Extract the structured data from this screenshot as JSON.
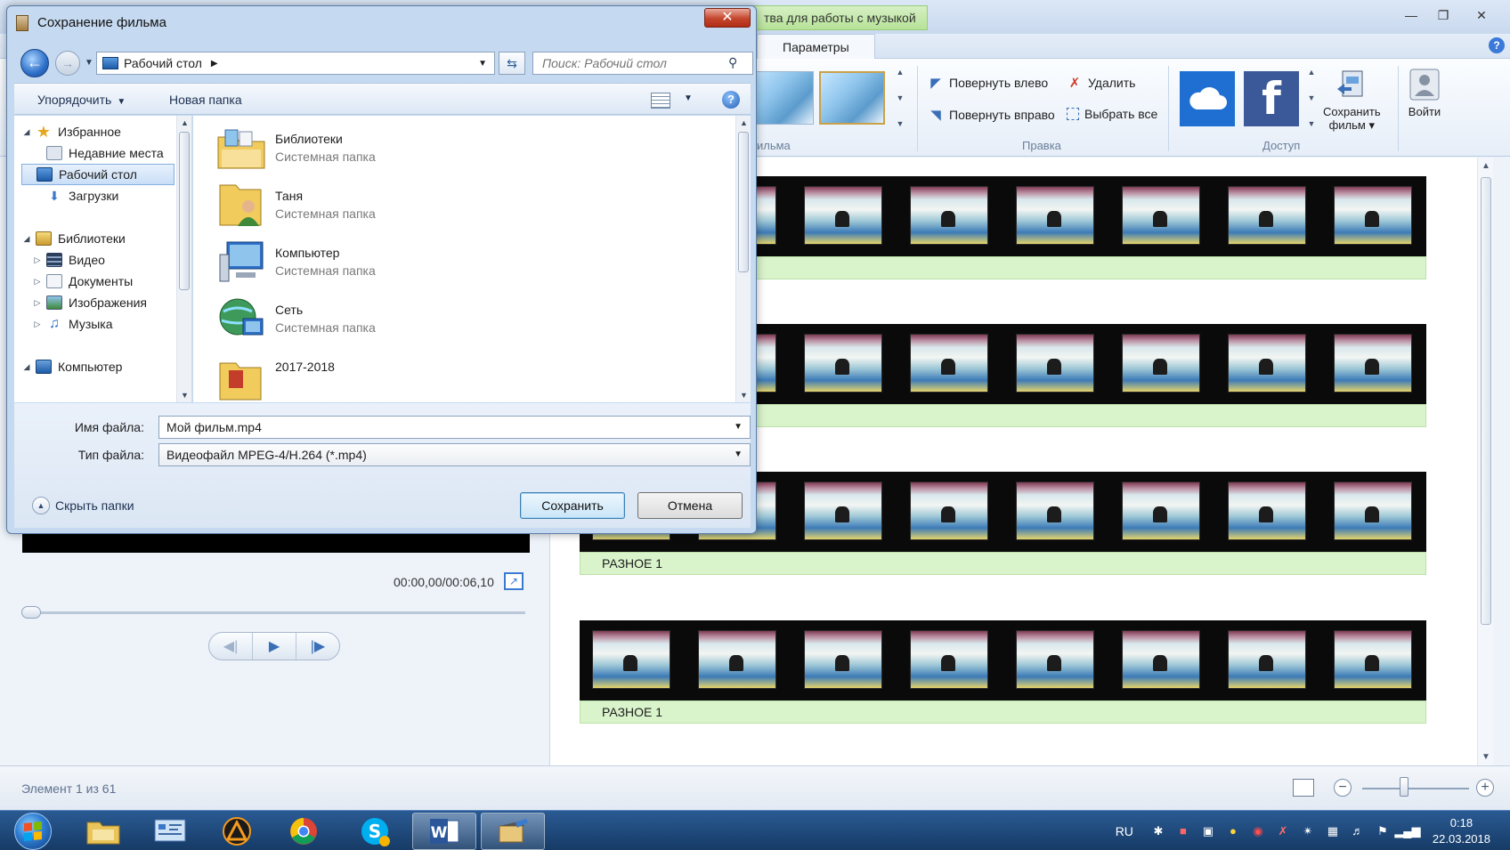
{
  "app": {
    "context_tab": "тва для работы с музыкой",
    "ribbon_tab": "Параметры",
    "groups": {
      "themes_label": "ильма",
      "edit_label": "Правка",
      "share_label": "Доступ"
    },
    "edit": {
      "rotate_left": "Повернуть влево",
      "rotate_right": "Повернуть вправо",
      "delete": "Удалить",
      "select_all": "Выбрать все"
    },
    "save_movie": {
      "line1": "Сохранить",
      "line2": "фильм"
    },
    "sign_in": "Войти",
    "clips": [
      {
        "caption": ""
      },
      {
        "caption": ""
      },
      {
        "caption": "РАЗНОЕ 1"
      },
      {
        "caption": "РАЗНОЕ 1"
      }
    ],
    "preview": {
      "timecode": "00:00,00/00:06,10"
    },
    "status": "Элемент 1 из 61",
    "colors": {
      "caption_bg": "#d9f3cb",
      "context_tab": "#b6e298"
    }
  },
  "dialog": {
    "title": "Сохранение фильма",
    "address": {
      "location": "Рабочий стол"
    },
    "search_placeholder": "Поиск: Рабочий стол",
    "commands": {
      "organize": "Упорядочить",
      "new_folder": "Новая папка"
    },
    "nav": {
      "favorites": "Избранное",
      "recent": "Недавние места",
      "desktop": "Рабочий стол",
      "downloads": "Загрузки",
      "libraries": "Библиотеки",
      "video": "Видео",
      "documents": "Документы",
      "images": "Изображения",
      "music": "Музыка",
      "computer": "Компьютер"
    },
    "files": [
      {
        "name": "Библиотеки",
        "type": "Системная папка",
        "icon": "libraries-icon"
      },
      {
        "name": "Таня",
        "type": "Системная папка",
        "icon": "user-folder-icon"
      },
      {
        "name": "Компьютер",
        "type": "Системная папка",
        "icon": "computer-icon"
      },
      {
        "name": "Сеть",
        "type": "Системная папка",
        "icon": "network-icon"
      },
      {
        "name": "2017-2018",
        "type": "",
        "icon": "folder-icon"
      }
    ],
    "filename_label": "Имя файла:",
    "filename_value": "Мой фильм.mp4",
    "filetype_label": "Тип файла:",
    "filetype_value": "Видеофайл MPEG-4/H.264 (*.mp4)",
    "hide_folders": "Скрыть папки",
    "save_button": "Сохранить",
    "cancel_button": "Отмена"
  },
  "taskbar": {
    "language": "RU",
    "time": "0:18",
    "date": "22.03.2018"
  }
}
